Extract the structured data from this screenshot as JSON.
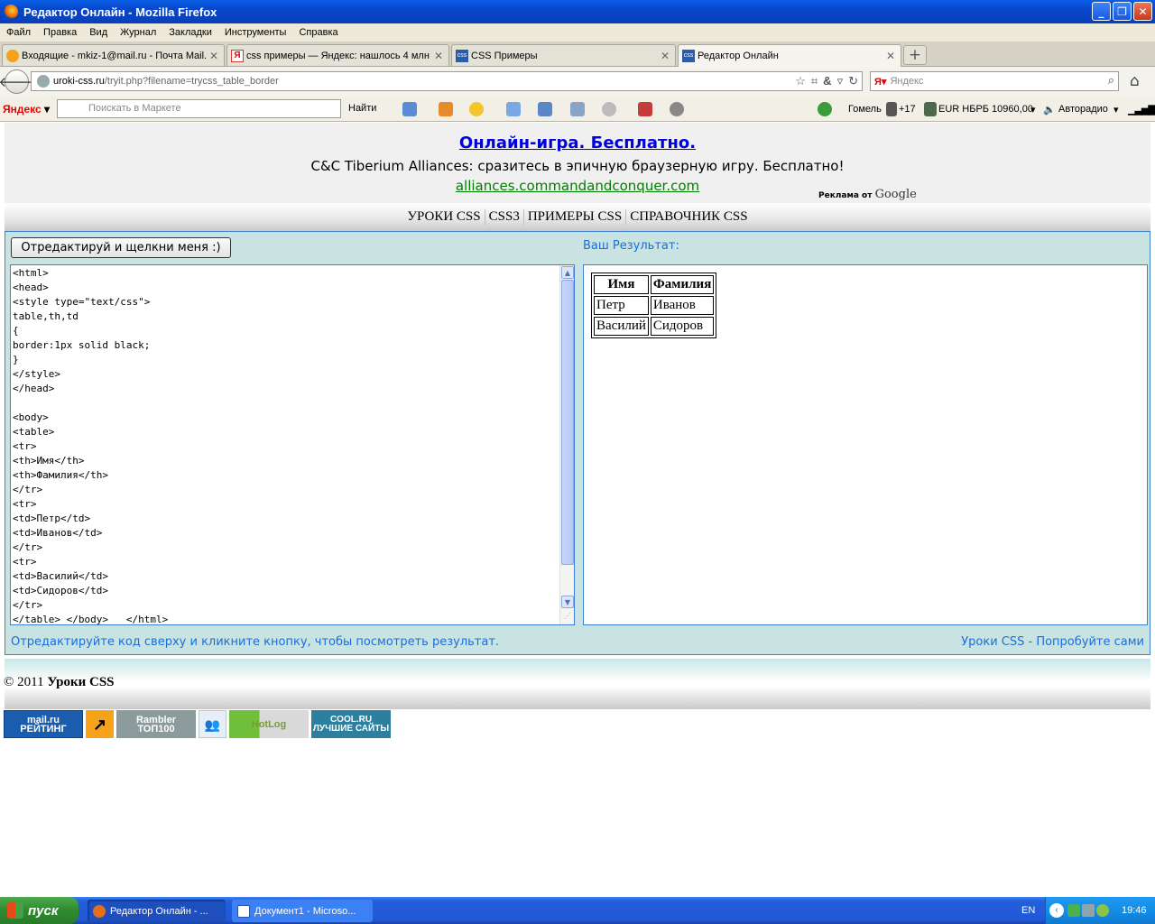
{
  "window": {
    "title": "Редактор Онлайн - Mozilla Firefox",
    "buttons": {
      "minimize": "_",
      "maximize": "❐",
      "close": "✕"
    }
  },
  "menu": [
    "Файл",
    "Правка",
    "Вид",
    "Журнал",
    "Закладки",
    "Инструменты",
    "Справка"
  ],
  "tabs": [
    {
      "label": "Входящие - mkiz-1@mail.ru - Почта Mail....",
      "icon": "mail-icon"
    },
    {
      "label": "css примеры — Яндекс: нашлось 4 млн ...",
      "icon": "yandex-icon"
    },
    {
      "label": "CSS Примеры",
      "icon": "css-icon"
    },
    {
      "label": "Редактор Онлайн",
      "icon": "css-icon",
      "active": true
    }
  ],
  "nav": {
    "url_host": "uroki-css.ru",
    "url_path": "/tryit.php?filename=trycss_table_border",
    "search_placeholder": "Яндекс"
  },
  "yandex_bar": {
    "logo": "Яндекс",
    "search_placeholder": "Поискать в Маркете",
    "find_label": "Найти",
    "city": "Гомель",
    "temperature": "+17",
    "currency": "EUR НБРБ 10960,00",
    "radio": "Авторадио"
  },
  "ad": {
    "title": "Онлайн-игра. Бесплатно.",
    "text": "C&C Tiberium Alliances: сразитесь в эпичную браузерную игру. Бесплатно!",
    "url": "alliances.commandandconquer.com",
    "byline_prefix": "Реклама от",
    "byline_brand": "Google"
  },
  "site_nav": [
    "УРОКИ CSS",
    "CSS3",
    "ПРИМЕРЫ CSS",
    "СПРАВОЧНИК CSS"
  ],
  "editor": {
    "run_button": "Отредактируй и щелкни меня :)",
    "result_label": "Ваш Результат:",
    "code": "<html>\n<head>\n<style type=\"text/css\">\ntable,th,td\n{\nborder:1px solid black;\n}\n</style>\n</head>\n\n<body>\n<table>\n<tr>\n<th>Имя</th>\n<th>Фамилия</th>\n</tr>\n<tr>\n<td>Петр</td>\n<td>Иванов</td>\n</tr>\n<tr>\n<td>Василий</td>\n<td>Сидоров</td>\n</tr>\n</table> </body>   </html>",
    "footer_left": "Отредактируйте код сверху и кликните кнопку, чтобы посмотреть результат.",
    "footer_right": "Уроки CSS - Попробуйте сами"
  },
  "result_table": {
    "headers": [
      "Имя",
      "Фамилия"
    ],
    "rows": [
      [
        "Петр",
        "Иванов"
      ],
      [
        "Василий",
        "Сидоров"
      ]
    ]
  },
  "footer": {
    "copyright": "© 2011",
    "site": "Уроки CSS"
  },
  "counters": [
    {
      "name": "mailru-rating-counter",
      "label": "mail.ru РЕЙТИНГ"
    },
    {
      "name": "liveinternet-counter",
      "label": "↗"
    },
    {
      "name": "rambler-top100-counter",
      "label": "Rambler ТОП100"
    },
    {
      "name": "people-counter",
      "label": ""
    },
    {
      "name": "hotlog-counter",
      "label": "HotLog"
    },
    {
      "name": "coolru-counter",
      "label": "COOL.RU ЛУЧШИЕ САЙТЫ"
    }
  ],
  "taskbar": {
    "start": "пуск",
    "items": [
      "Редактор Онлайн - ...",
      "Документ1 - Microso..."
    ],
    "lang": "EN",
    "clock": "19:46"
  },
  "colors": {
    "title_bar": "#0a5ee6",
    "link": "#1a6ed8",
    "editor_bg": "#c9e3e3",
    "ad_title": "#0000dd",
    "ad_url": "#008000"
  }
}
